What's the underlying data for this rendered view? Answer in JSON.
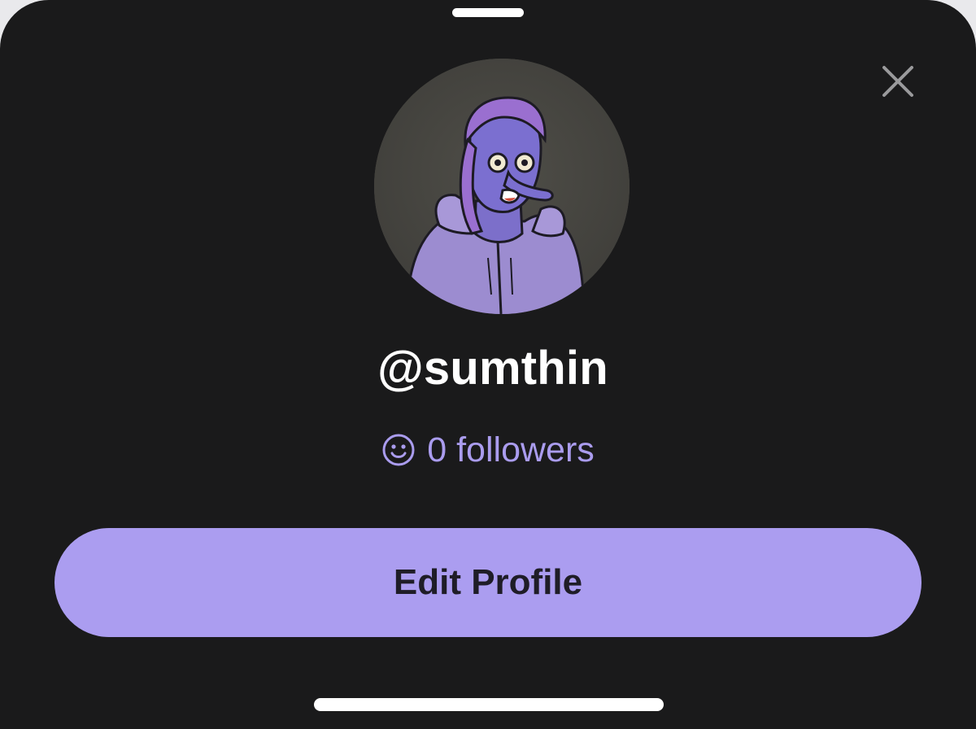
{
  "profile": {
    "handle": "@sumthin",
    "followers_text": "0 followers",
    "avatar": "nft-character-avatar"
  },
  "actions": {
    "edit_profile_label": "Edit Profile"
  },
  "icons": {
    "close": "close-icon",
    "followers": "smiley-face-icon"
  },
  "colors": {
    "background": "#1a1a1b",
    "accent": "#ab9df0",
    "accent_text": "#aa9cee",
    "button_text": "#1f1d27"
  }
}
